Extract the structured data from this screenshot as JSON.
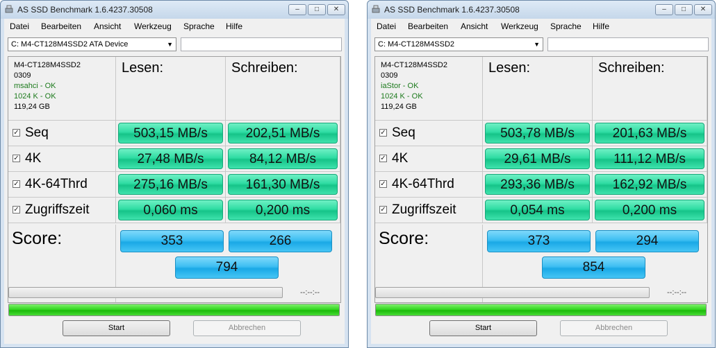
{
  "windows": [
    {
      "title": "AS SSD Benchmark 1.6.4237.30508",
      "menu": [
        "Datei",
        "Bearbeiten",
        "Ansicht",
        "Werkzeug",
        "Sprache",
        "Hilfe"
      ],
      "drive": "C: M4-CT128M4SSD2 ATA Device",
      "info": {
        "model": "M4-CT128M4SSD2",
        "firmware": "0309",
        "driver": "msahci - OK",
        "alignment": "1024 K - OK",
        "size": "119,24 GB"
      },
      "headers": {
        "read": "Lesen:",
        "write": "Schreiben:"
      },
      "rows": [
        {
          "label": "Seq",
          "read": "503,15 MB/s",
          "write": "202,51 MB/s"
        },
        {
          "label": "4K",
          "read": "27,48 MB/s",
          "write": "84,12 MB/s"
        },
        {
          "label": "4K-64Thrd",
          "read": "275,16 MB/s",
          "write": "161,30 MB/s"
        },
        {
          "label": "Zugriffszeit",
          "read": "0,060 ms",
          "write": "0,200 ms"
        }
      ],
      "score": {
        "label": "Score:",
        "read": "353",
        "write": "266",
        "total": "794"
      },
      "time": "--:--:--",
      "progress": 1.0,
      "buttons": {
        "start": "Start",
        "abort": "Abbrechen"
      }
    },
    {
      "title": "AS SSD Benchmark 1.6.4237.30508",
      "menu": [
        "Datei",
        "Bearbeiten",
        "Ansicht",
        "Werkzeug",
        "Sprache",
        "Hilfe"
      ],
      "drive": "C: M4-CT128M4SSD2",
      "info": {
        "model": "M4-CT128M4SSD2",
        "firmware": "0309",
        "driver": "iaStor - OK",
        "alignment": "1024 K - OK",
        "size": "119,24 GB"
      },
      "headers": {
        "read": "Lesen:",
        "write": "Schreiben:"
      },
      "rows": [
        {
          "label": "Seq",
          "read": "503,78 MB/s",
          "write": "201,63 MB/s"
        },
        {
          "label": "4K",
          "read": "29,61 MB/s",
          "write": "111,12 MB/s"
        },
        {
          "label": "4K-64Thrd",
          "read": "293,36 MB/s",
          "write": "162,92 MB/s"
        },
        {
          "label": "Zugriffszeit",
          "read": "0,054 ms",
          "write": "0,200 ms"
        }
      ],
      "score": {
        "label": "Score:",
        "read": "373",
        "write": "294",
        "total": "854"
      },
      "time": "--:--:--",
      "progress": 1.0,
      "buttons": {
        "start": "Start",
        "abort": "Abbrechen"
      }
    }
  ],
  "icons": {
    "app": "drive-icon",
    "minimize": "minimize-icon",
    "maximize": "maximize-icon",
    "close": "close-icon",
    "check": "checkmark-icon",
    "dropdown": "chevron-down-icon"
  },
  "colors": {
    "value_box": "#2fdca3",
    "score_box": "#3dbef2",
    "progress_fill": "#2ed41b",
    "ok_text": "#1c7a1c"
  }
}
